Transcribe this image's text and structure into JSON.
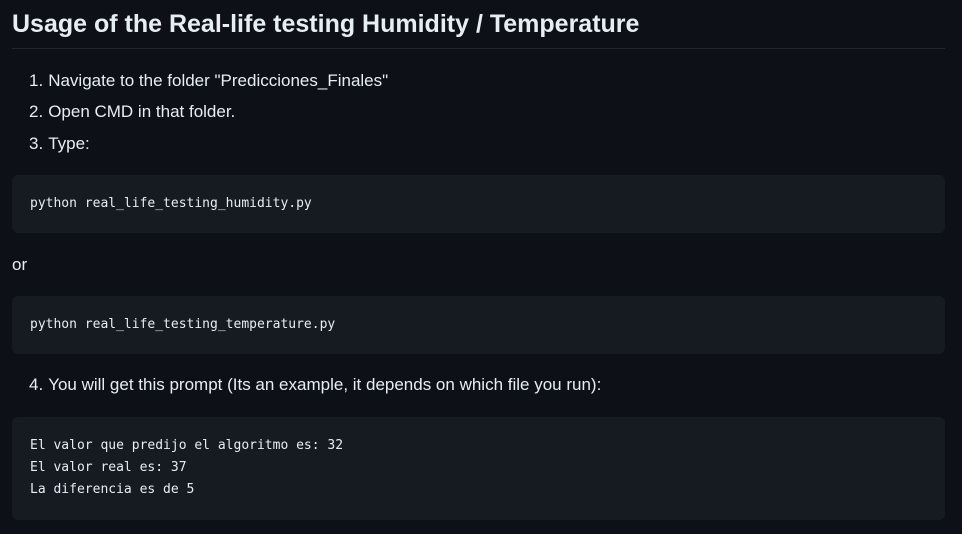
{
  "readme": {
    "title": "Usage of the Real-life testing Humidity / Temperature",
    "steps": [
      {
        "number": "1.",
        "text": "Navigate to the folder \"Predicciones_Finales\""
      },
      {
        "number": "2.",
        "text": "Open CMD in that folder."
      },
      {
        "number": "3.",
        "text": "Type:"
      },
      {
        "number": "4.",
        "text": "You will get this prompt (Its an example, it depends on which file you run):"
      }
    ],
    "code_humidity": "python real_life_testing_humidity.py",
    "separator": "or",
    "code_temperature": "python real_life_testing_temperature.py",
    "output_lines": [
      "El valor que predijo el algoritmo es: 32",
      "El valor real es: 37",
      "La diferencia es de 5"
    ]
  },
  "colors": {
    "background": "#0d1117",
    "code_background": "#161b22",
    "text": "#e6edf3",
    "divider": "#21262d"
  }
}
